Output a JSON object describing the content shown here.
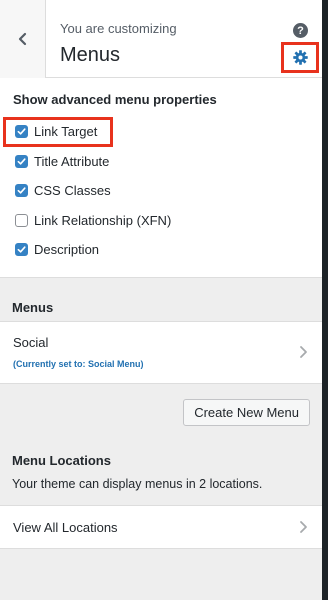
{
  "header": {
    "subtitle": "You are customizing",
    "title": "Menus",
    "help_glyph": "?"
  },
  "options": {
    "title": "Show advanced menu properties",
    "items": [
      {
        "label": "Link Target",
        "checked": true
      },
      {
        "label": "Title Attribute",
        "checked": true
      },
      {
        "label": "CSS Classes",
        "checked": true
      },
      {
        "label": "Link Relationship (XFN)",
        "checked": false
      },
      {
        "label": "Description",
        "checked": true
      }
    ]
  },
  "menus": {
    "heading": "Menus",
    "items": [
      {
        "name": "Social",
        "status": "(Currently set to: Social Menu)"
      }
    ],
    "create_label": "Create New Menu"
  },
  "locations": {
    "heading": "Menu Locations",
    "description": "Your theme can display menus in 2 locations.",
    "view_all_label": "View All Locations"
  },
  "colors": {
    "accent": "#3582c4",
    "highlight": "#e8321d",
    "link": "#2271b1"
  },
  "icons": {
    "back": "chevron-left-icon",
    "help": "help-icon",
    "settings": "gear-icon",
    "check": "check-icon",
    "forward": "chevron-right-icon"
  }
}
